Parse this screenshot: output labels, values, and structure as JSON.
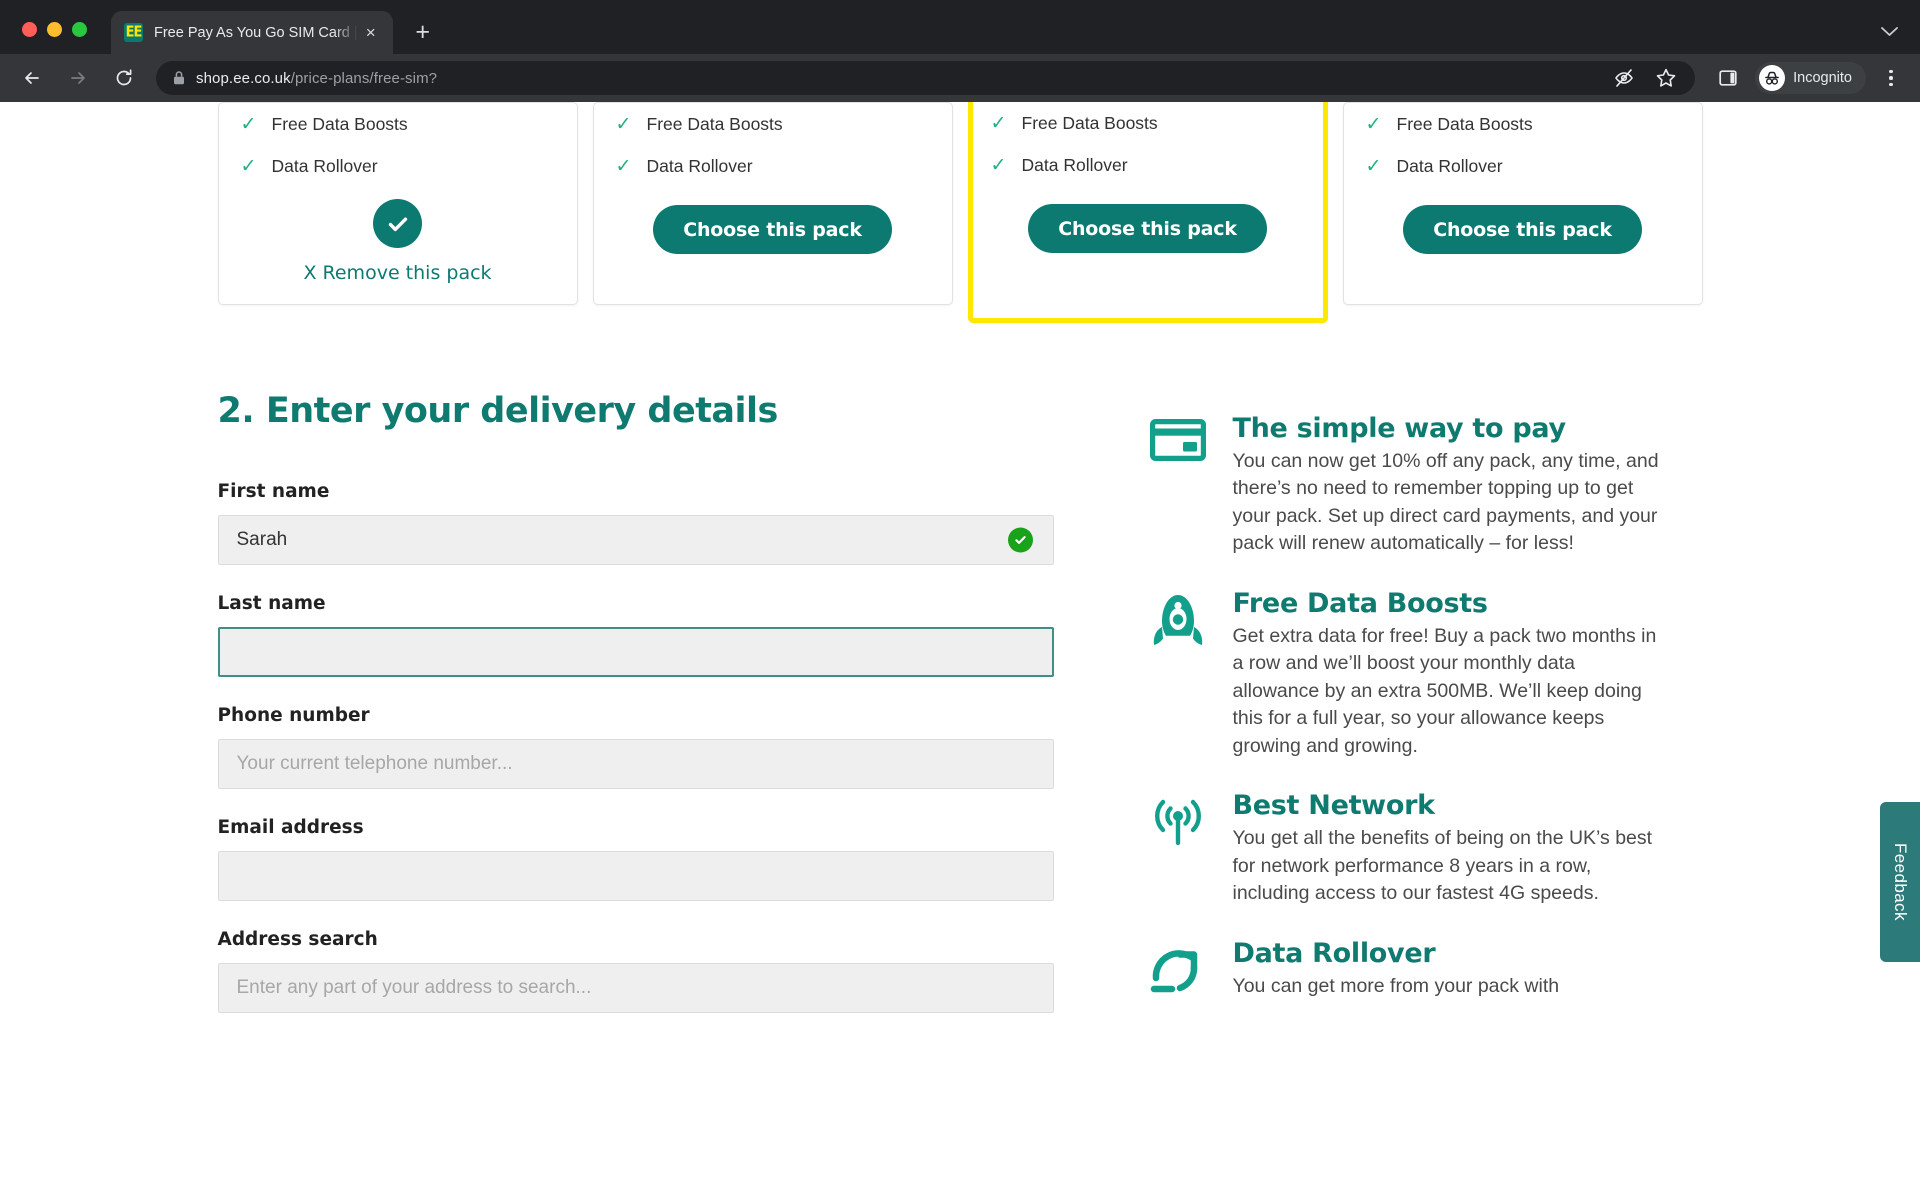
{
  "browser": {
    "tab": {
      "title": "Free Pay As You Go SIM Card |",
      "favicon_text": "EE",
      "favicon_name": "ee-logo-icon",
      "close_label": "×"
    },
    "new_tab_label": "+",
    "collapse_label": "⌄",
    "omnibox": {
      "domain": "shop.ee.co.uk",
      "path": "/price-plans/free-sim?",
      "lock_icon": "padlock-icon"
    },
    "actions": {
      "third_party_cookies": "eye-slash-icon",
      "bookmark": "star-icon",
      "side_panel": "side-panel-icon",
      "profile_label": "Incognito",
      "menu": "kebab-menu-icon"
    },
    "nav": {
      "back": "back-arrow-icon",
      "forward": "forward-arrow-icon",
      "reload": "reload-icon"
    }
  },
  "packs": {
    "features": [
      "Free Data Boosts",
      "Data Rollover"
    ],
    "choose_label": "Choose this pack",
    "remove_label": "X Remove this pack",
    "items": [
      {
        "state": "selected",
        "highlighted": false
      },
      {
        "state": "available",
        "highlighted": false
      },
      {
        "state": "available",
        "highlighted": true
      },
      {
        "state": "available",
        "highlighted": false
      }
    ]
  },
  "delivery": {
    "title": "2. Enter your delivery details",
    "fields": [
      {
        "label": "First name",
        "value": "Sarah",
        "placeholder": "",
        "valid": true,
        "focused": false
      },
      {
        "label": "Last name",
        "value": "",
        "placeholder": "",
        "valid": false,
        "focused": true
      },
      {
        "label": "Phone number",
        "value": "",
        "placeholder": "Your current telephone number...",
        "valid": false,
        "focused": false
      },
      {
        "label": "Email address",
        "value": "",
        "placeholder": "",
        "valid": false,
        "focused": false
      },
      {
        "label": "Address search",
        "value": "",
        "placeholder": "Enter any part of your address to search...",
        "valid": false,
        "focused": false
      }
    ]
  },
  "benefits": [
    {
      "icon": "credit-card-icon",
      "title": "The simple way to pay",
      "body": "You can now get 10% off any pack, any time, and there’s no need to remember topping up to get your pack. Set up direct card payments, and your pack will renew automatically – for less!"
    },
    {
      "icon": "rocket-icon",
      "title": "Free Data Boosts",
      "body": "Get extra data for free! Buy a pack two months in a row and we’ll boost your monthly data allowance by an extra 500MB. We’ll keep doing this for a full year, so your allowance keeps growing and growing."
    },
    {
      "icon": "signal-antenna-icon",
      "title": "Best Network",
      "body": "You get all the benefits of being on the UK’s best for network performance 8 years in a row, including access to our fastest 4G speeds."
    },
    {
      "icon": "rollover-arrow-icon",
      "title": "Data Rollover",
      "body": "You can get more from your pack with"
    }
  ],
  "feedback": {
    "label": "Feedback"
  },
  "colors": {
    "brand_teal": "#0d7a71",
    "heading_teal": "#0f7a6f",
    "highlight_yellow": "#ffe800",
    "valid_green": "#1aa31a",
    "tick_green": "#22b07d",
    "feedback_teal": "#2d7a7a"
  }
}
